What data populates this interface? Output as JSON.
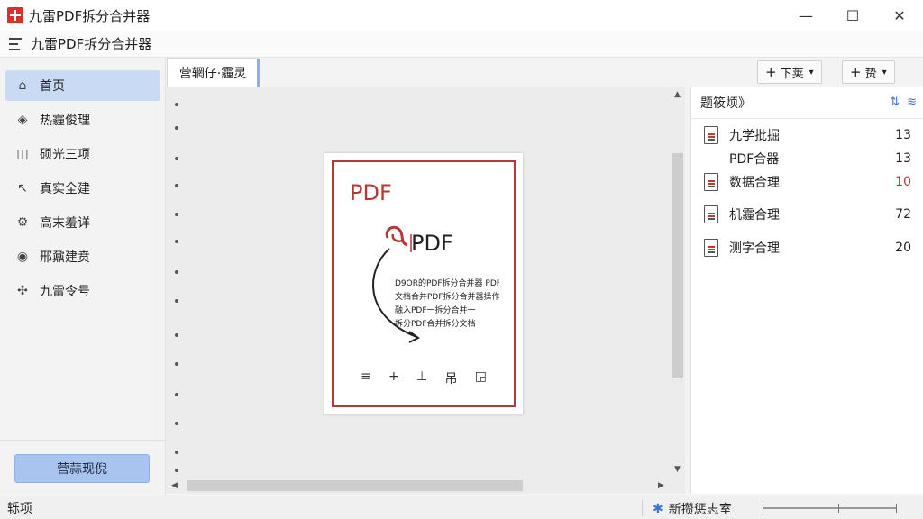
{
  "window": {
    "title": "九雷PDF拆分合并器",
    "controls": {
      "minimize": "—",
      "maximize": "☐",
      "close": "✕"
    }
  },
  "menubar": {
    "title": "九雷PDF拆分合并器"
  },
  "sidebar": {
    "items": [
      {
        "label": "首页",
        "icon": "home-icon",
        "glyph": "⌂",
        "active": true
      },
      {
        "label": "热霾俊理",
        "icon": "tag-icon",
        "glyph": "◈",
        "active": false
      },
      {
        "label": "硕光三项",
        "icon": "bookmark-icon",
        "glyph": "◫",
        "active": false
      },
      {
        "label": "真实全建",
        "icon": "pointer-icon",
        "glyph": "↖",
        "active": false
      },
      {
        "label": "高末羞详",
        "icon": "gear-icon",
        "glyph": "⚙",
        "active": false
      },
      {
        "label": "邢鼐建贲",
        "icon": "clock-icon",
        "glyph": "◉",
        "active": false
      },
      {
        "label": "九雷令号",
        "icon": "puzzle-icon",
        "glyph": "✣",
        "active": false
      }
    ],
    "bottom_button": "营蒜现倪"
  },
  "tabs": {
    "doc_tab": "营辋仔·霾灵",
    "tool_buttons": [
      {
        "label": "下荚",
        "plus": "+",
        "caret": "▾"
      },
      {
        "label": "贽",
        "plus": "+",
        "caret": "▾"
      }
    ]
  },
  "preview": {
    "title_big": "PDF",
    "title_med": "PDF",
    "lines": [
      "D9OR的PDF拆分合并器 PDF",
      "文档合并PDF拆分合并器操作",
      "融入PDF一拆分合并一",
      "拆分PDF合并拆分文档"
    ],
    "icons": [
      "≡",
      "+",
      "⊥",
      "吊",
      "◲"
    ]
  },
  "right_panel": {
    "header": "题筱烦》",
    "header_icons": [
      "sort-icon",
      "collapse-icon"
    ],
    "files": [
      {
        "name": "九学批掘",
        "count": "13",
        "icon": "pdf-file-icon",
        "red": false
      },
      {
        "name": "PDF合器",
        "count": "13",
        "icon": "",
        "red": false
      },
      {
        "name": "数据合理",
        "count": "10",
        "icon": "pdf-file-icon",
        "red": true
      },
      {
        "name": "机霾合理",
        "count": "72",
        "icon": "file-icon",
        "red": false
      },
      {
        "name": "测字合理",
        "count": "20",
        "icon": "pdf-file-icon",
        "red": false
      }
    ]
  },
  "statusbar": {
    "left": "轹项",
    "right": "新攒惩志室"
  },
  "colors": {
    "accent": "#3a74d8",
    "active_nav": "#c9daf5",
    "brand_red": "#b13a36"
  }
}
